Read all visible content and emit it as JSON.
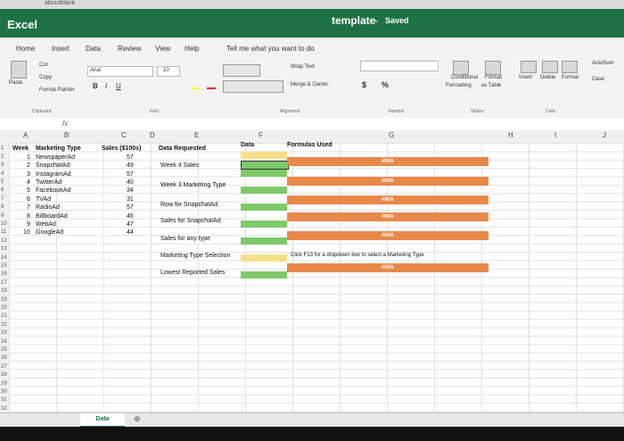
{
  "browser": {
    "url_text": "aboutblank"
  },
  "title": {
    "app": "Excel",
    "doc": "template",
    "sep": "-",
    "status": "Saved"
  },
  "tabs": [
    "Home",
    "Insert",
    "Data",
    "Review",
    "View",
    "Help"
  ],
  "tell_me": "Tell me what you want to do",
  "ribbon": {
    "paste": "Paste",
    "cut": "Cut",
    "copy": "Copy",
    "format_painter": "Format Painter",
    "clipboard": "Clipboard",
    "font_name": "Arial",
    "font_size": "10",
    "font": "Font",
    "wrap_text": "Wrap Text",
    "merge": "Merge & Center",
    "alignment": "Alignment",
    "number": "Number",
    "conditional": "Conditional",
    "formatting": "Formatting",
    "format_as": "Format",
    "as_table": "as Table",
    "tables": "Tables",
    "insert": "Insert",
    "delete": "Delete",
    "format": "Format",
    "cells": "Cells",
    "autosum": "AutoSum",
    "clear": "Clear"
  },
  "formula_bar": {
    "fx": "fx"
  },
  "columns": [
    "A",
    "B",
    "C",
    "D",
    "E",
    "F",
    "G",
    "H",
    "I",
    "J"
  ],
  "rows": [
    "1",
    "2",
    "3",
    "4",
    "5",
    "6",
    "7",
    "8",
    "9",
    "10",
    "11",
    "12",
    "13",
    "14",
    "15",
    "16",
    "17",
    "18",
    "19",
    "20",
    "21",
    "22",
    "23",
    "24",
    "25",
    "26",
    "27",
    "28",
    "29",
    "30",
    "31",
    "32"
  ],
  "headers": {
    "week": "Week",
    "marketing_type": "Marketing Type",
    "sales": "Sales ($100s)",
    "data_requested": "Data Requested",
    "data": "Data",
    "formulas_used": "Formulas Used"
  },
  "table": [
    {
      "week": "1",
      "type": "NewspaperAd",
      "sales": "57"
    },
    {
      "week": "2",
      "type": "SnapchatAd",
      "sales": "49"
    },
    {
      "week": "3",
      "type": "InstagramAd",
      "sales": "57"
    },
    {
      "week": "4",
      "type": "TwitterAd",
      "sales": "40"
    },
    {
      "week": "5",
      "type": "FacebookAd",
      "sales": "34"
    },
    {
      "week": "6",
      "type": "TVAd",
      "sales": "31"
    },
    {
      "week": "7",
      "type": "RadioAd",
      "sales": "57"
    },
    {
      "week": "8",
      "type": "BillboardAd",
      "sales": "46"
    },
    {
      "week": "9",
      "type": "WebAd",
      "sales": "47"
    },
    {
      "week": "10",
      "type": "GoogleAd",
      "sales": "44"
    }
  ],
  "requests": {
    "r1": "Week 4 Sales",
    "r2": "Week 3 Marketing Type",
    "r3": "Row for SnapchatAd",
    "r4": "Sales for SnapchatAd",
    "r5": "Sales for any type",
    "r6": "Marketing Type Selection",
    "r7": "Lowest Reported Sales"
  },
  "errors": {
    "na": "#N/A"
  },
  "note": "Click F13 for a dropdown box to select a Marketing Type",
  "sheet_tab": "Data",
  "colors": {
    "excel_green": "#1e7145",
    "orange": "#e8894a",
    "green_cell": "#7ec96a",
    "yellow_cell": "#f5e08a"
  }
}
